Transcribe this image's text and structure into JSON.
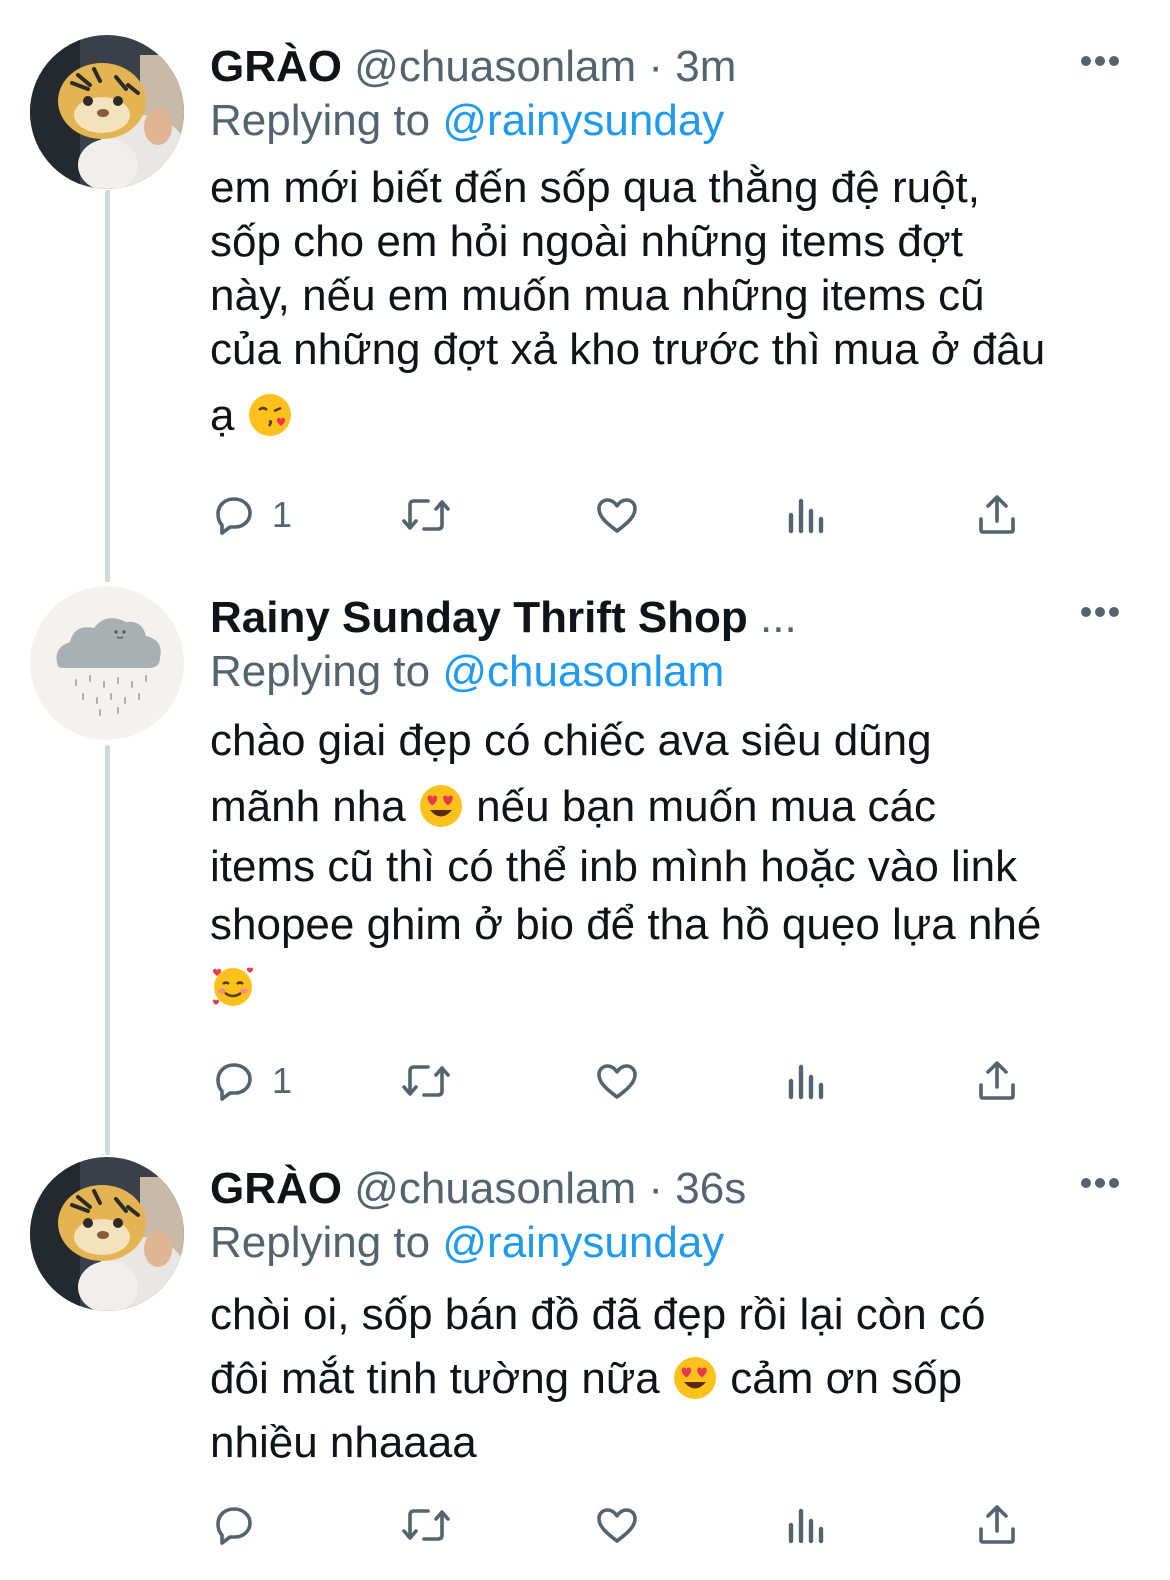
{
  "tweets": [
    {
      "name": "GRÀO",
      "handle": "@chuasonlam",
      "separator": "·",
      "time": "3m",
      "replying_prefix": "Replying to",
      "replying_to": "@rainysunday",
      "text_lines": [
        "em mới biết đến sốp qua thằng đệ ruột,",
        "sốp cho em hỏi ngoài những items đợt",
        "này, nếu em muốn mua những items cũ",
        "của những đợt xả kho trước thì mua ở đâu",
        "ạ"
      ],
      "emojis": [
        "kissing-heart-emoji"
      ],
      "reply_count": "1"
    },
    {
      "name": "Rainy Sunday Thrift Shop",
      "name_ellipsis": "...",
      "replying_prefix": "Replying to",
      "replying_to": "@chuasonlam",
      "text_lines": [
        "chào giai đẹp có chiếc ava siêu dũng",
        "mãnh nha",
        "nếu bạn muốn mua các",
        "items cũ thì có thể inb mình hoặc vào link",
        "shopee ghim ở bio để tha hồ quẹo lựa nhé"
      ],
      "emojis": [
        "heart-eyes-emoji",
        "smiling-hearts-emoji"
      ],
      "reply_count": "1"
    },
    {
      "name": "GRÀO",
      "handle": "@chuasonlam",
      "separator": "·",
      "time": "36s",
      "replying_prefix": "Replying to",
      "replying_to": "@rainysunday",
      "text_lines": [
        "chòi oi, sốp bán đồ đã đẹp rồi lại còn có",
        "đôi mắt tinh tường nữa",
        "cảm ơn sốp",
        "nhiều nhaaaa"
      ],
      "emojis": [
        "heart-eyes-emoji"
      ],
      "reply_count": ""
    }
  ],
  "icons": [
    "reply-icon",
    "retweet-icon",
    "like-icon",
    "analytics-icon",
    "share-icon",
    "more-options-icon"
  ],
  "colors": {
    "text": "#0f1419",
    "secondary": "#536471",
    "link": "#1d9bf0",
    "thread_line": "#cfd9de"
  }
}
